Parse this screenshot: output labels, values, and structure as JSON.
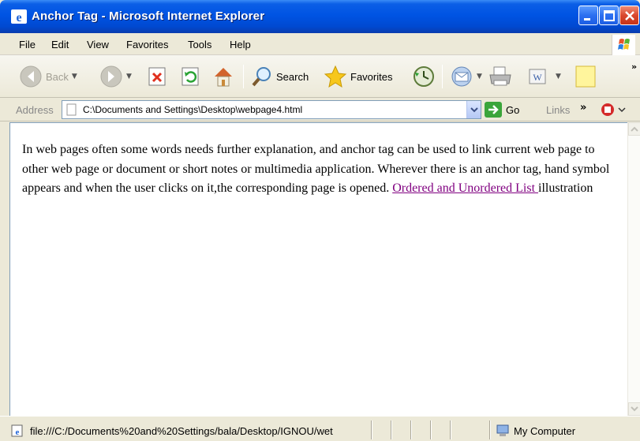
{
  "window": {
    "title": "Anchor Tag - Microsoft Internet Explorer"
  },
  "menu": [
    "File",
    "Edit",
    "View",
    "Favorites",
    "Tools",
    "Help"
  ],
  "toolbar": {
    "back_label": "Back",
    "search_label": "Search",
    "favorites_label": "Favorites"
  },
  "address": {
    "label": "Address",
    "url": "C:\\Documents and Settings\\Desktop\\webpage4.html",
    "go_label": "Go",
    "links_label": "Links",
    "more": "»"
  },
  "page": {
    "text_before": "In web pages often some words needs further explanation, and anchor tag can be used to link current web page to other web page or document or short notes or multimedia application. Wherever there is an anchor tag, hand symbol appears and when the user clicks on it,the corresponding page is opened. ",
    "link_text": "Ordered and Unordered List ",
    "text_after": "illustration",
    "link_color": "#800080"
  },
  "status": {
    "text": "file:///C:/Documents%20and%20Settings/bala/Desktop/IGNOU/wet",
    "zone": "My Computer"
  },
  "icons": {
    "title": "ie-icon",
    "back": "back-arrow-icon",
    "forward": "forward-arrow-icon",
    "stop": "stop-icon",
    "refresh": "refresh-icon",
    "home": "home-icon",
    "search": "search-icon",
    "favorites": "favorites-star-icon",
    "history": "history-icon",
    "mail": "mail-icon",
    "print": "print-icon",
    "edit": "word-edit-icon",
    "messenger": "note-icon",
    "go": "go-arrow-icon",
    "zone": "my-computer-icon"
  },
  "colors": {
    "titlebar": "#0054e3",
    "chrome": "#ece9d8",
    "visited_link": "#800080"
  }
}
